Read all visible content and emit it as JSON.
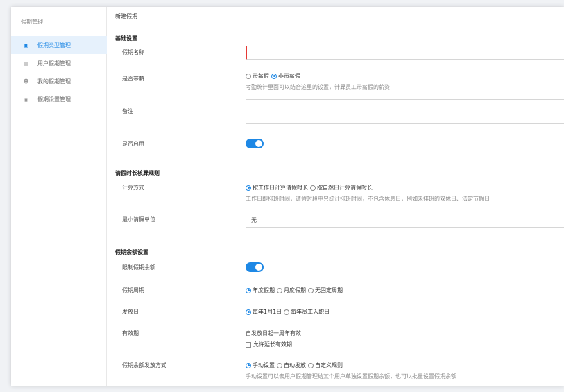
{
  "sidebar": {
    "title": "假期管理",
    "items": [
      {
        "label": "假期类型管理",
        "icon": "calendar-icon",
        "active": true
      },
      {
        "label": "用户假期管理",
        "icon": "calendar-user-icon",
        "active": false
      },
      {
        "label": "我的假期管理",
        "icon": "user-icon",
        "active": false
      },
      {
        "label": "假期设置管理",
        "icon": "settings-icon",
        "active": false
      }
    ]
  },
  "header": {
    "title": "新建假期"
  },
  "basic": {
    "section_title": "基础设置",
    "name_label": "假期名称",
    "name_value": "",
    "paid_label": "是否带薪",
    "paid_options": [
      "带薪假",
      "非带薪假"
    ],
    "paid_selected": 1,
    "paid_hint": "考勤统计里面可以结合这里的设置，计算员工带薪假的薪资",
    "remark_label": "备注",
    "remark_value": "",
    "enabled_label": "是否启用",
    "enabled": true
  },
  "rules": {
    "section_title": "请假时长核算规则",
    "method_label": "计算方式",
    "method_options": [
      "按工作日计算请假时长",
      "按自然日计算请假时长"
    ],
    "method_selected": 0,
    "method_hint": "工作日即排班时间，请假时段中只统计排班时间，不包含休息日，例如未排班的双休日、法定节假日",
    "min_unit_label": "最小请假单位",
    "min_unit_value": "无"
  },
  "balance": {
    "section_title": "假期余额设置",
    "limit_label": "限制假期余额",
    "limit_enabled": true,
    "cycle_label": "假期周期",
    "cycle_options": [
      "年度假期",
      "月度假期",
      "无固定周期"
    ],
    "cycle_selected": 0,
    "issue_label": "发放日",
    "issue_options": [
      "每年1月1日",
      "每年员工入职日"
    ],
    "issue_selected": 0,
    "validity_label": "有效期",
    "validity_text": "自发放日起一周年有效",
    "extend_label": "允许延长有效期",
    "extend_checked": false,
    "method_label": "假期余额发放方式",
    "method_options": [
      "手动设置",
      "自动发放",
      "自定义规则"
    ],
    "method_selected": 0,
    "method_hint": "手动设置可以去用户假期管理给某个用户单独设置假期余额，也可以批量设置假期余额"
  },
  "colors": {
    "accent": "#1e88e5",
    "focus_border": "#e53935",
    "active_bg": "#e6f1fc"
  }
}
